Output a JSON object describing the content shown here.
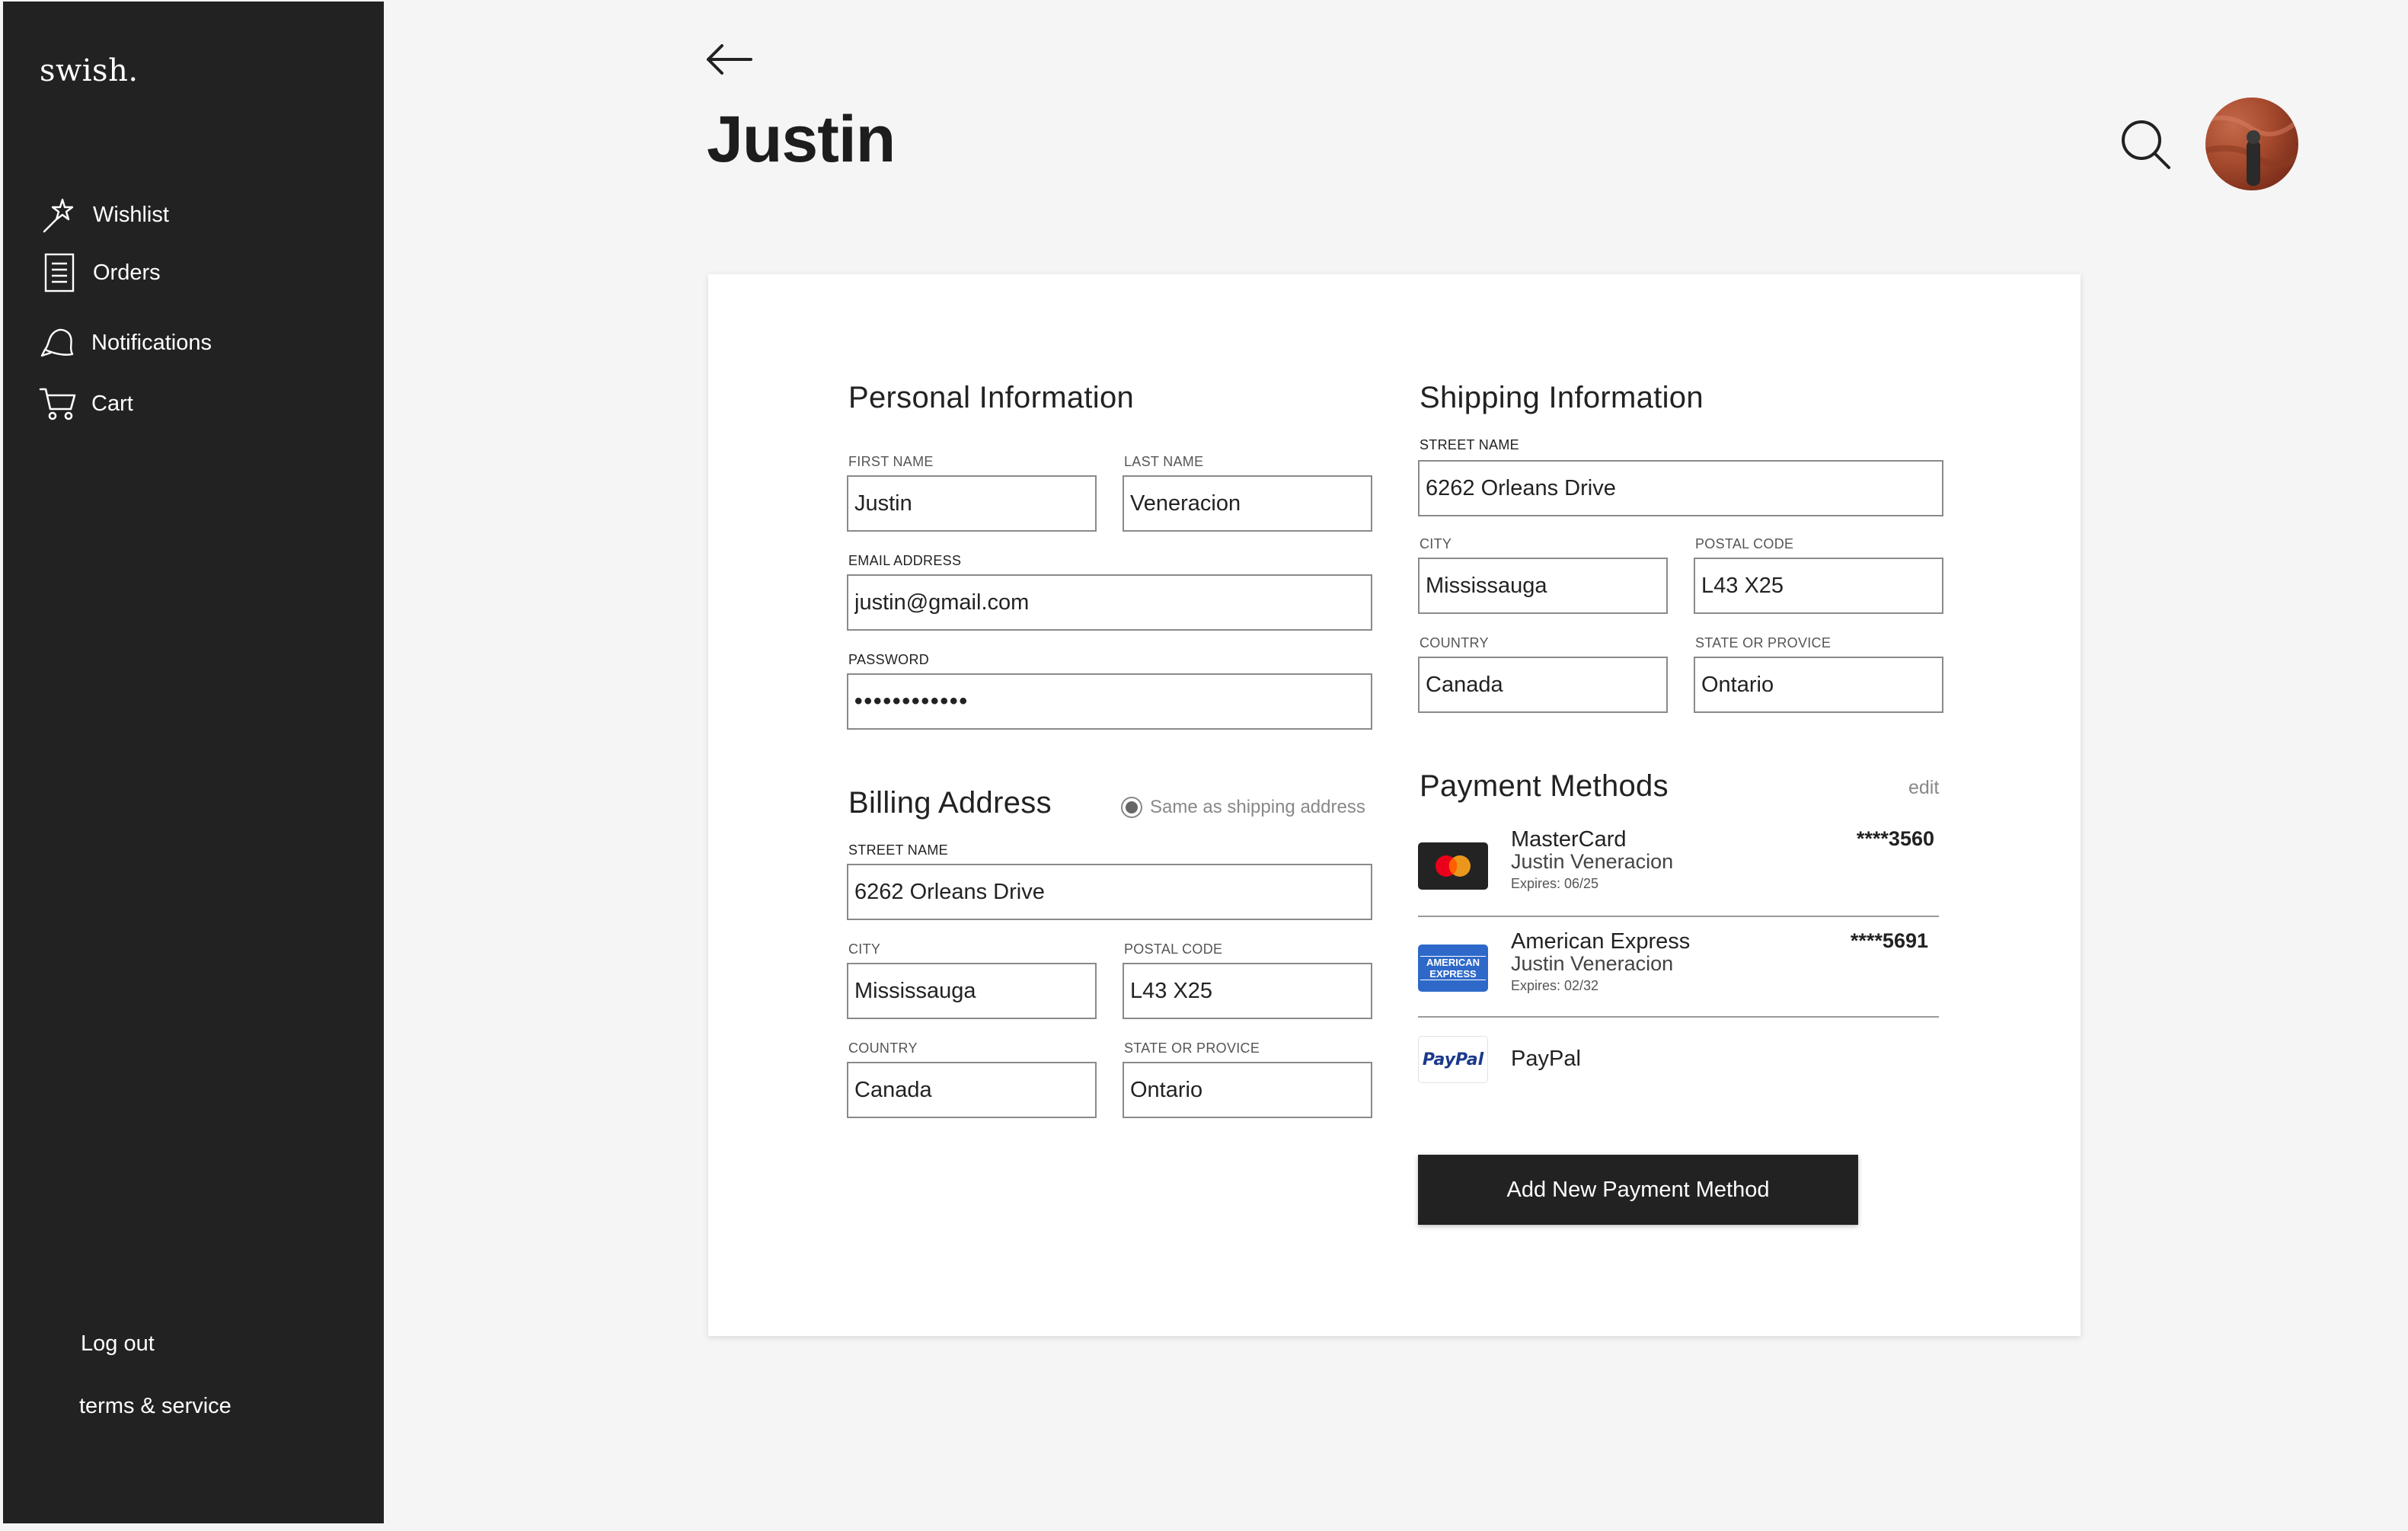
{
  "app": {
    "logo": "swish."
  },
  "sidebar": {
    "items": [
      {
        "label": "Wishlist",
        "icon": "wand-icon"
      },
      {
        "label": "Orders",
        "icon": "document-icon"
      },
      {
        "label": "Notifications",
        "icon": "bell-icon"
      },
      {
        "label": "Cart",
        "icon": "cart-icon"
      }
    ],
    "logout": "Log out",
    "terms": "terms & service"
  },
  "header": {
    "title": "Justin"
  },
  "personal": {
    "title": "Personal Information",
    "first_name_label": "FIRST NAME",
    "first_name": "Justin",
    "last_name_label": "LAST NAME",
    "last_name": "Veneracion",
    "email_label": "EMAIL ADDRESS",
    "email": "justin@gmail.com",
    "password_label": "PASSWORD",
    "password": "••••••••••••"
  },
  "shipping": {
    "title": "Shipping Information",
    "street_label": "STREET NAME",
    "street": "6262 Orleans Drive",
    "city_label": "CITY",
    "city": "Mississauga",
    "postal_label": "POSTAL CODE",
    "postal": "L43 X25",
    "country_label": "COUNTRY",
    "country": "Canada",
    "state_label": "STATE OR PROVICE",
    "state": "Ontario"
  },
  "billing": {
    "title": "Billing Address",
    "same_as_shipping": "Same as shipping address",
    "street_label": "STREET NAME",
    "street": "6262 Orleans Drive",
    "city_label": "CITY",
    "city": "Mississauga",
    "postal_label": "POSTAL CODE",
    "postal": "L43 X25",
    "country_label": "COUNTRY",
    "country": "Canada",
    "state_label": "STATE OR PROVICE",
    "state": "Ontario"
  },
  "payment": {
    "title": "Payment Methods",
    "edit": "edit",
    "methods": [
      {
        "brand": "MasterCard",
        "holder": "Justin Veneracion",
        "expires": "Expires: 06/25",
        "number": "****3560"
      },
      {
        "brand": "American Express",
        "holder": "Justin Veneracion",
        "expires": "Expires: 02/32",
        "number": "****5691",
        "icon_text": "AMERICAN EXPRESS"
      },
      {
        "brand": "PayPal",
        "icon_text": "PayPal"
      }
    ],
    "add_button": "Add New Payment Method"
  },
  "colors": {
    "sidebar": "#222222",
    "background": "#f5f5f5",
    "card": "#ffffff",
    "button": "#222222",
    "amex_blue": "#2e69c9",
    "mastercard_red": "#eb001b",
    "mastercard_orange": "#f79e1b"
  }
}
